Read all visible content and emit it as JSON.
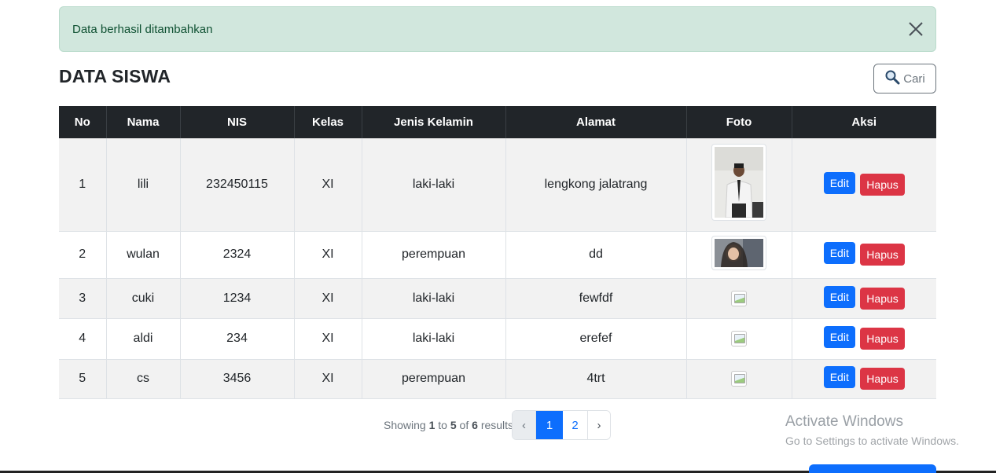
{
  "alert": {
    "message": "Data berhasil ditambahkan"
  },
  "page": {
    "title": "DATA SISWA"
  },
  "search": {
    "label": "Cari"
  },
  "table": {
    "columns": [
      "No",
      "Nama",
      "NIS",
      "Kelas",
      "Jenis Kelamin",
      "Alamat",
      "Foto",
      "Aksi"
    ],
    "rows": [
      {
        "no": "1",
        "nama": "lili",
        "nis": "232450115",
        "kelas": "XI",
        "jenis_kelamin": "laki-laki",
        "alamat": "lengkong jalatrang",
        "foto": "portrait-photo"
      },
      {
        "no": "2",
        "nama": "wulan",
        "nis": "2324",
        "kelas": "XI",
        "jenis_kelamin": "perempuan",
        "alamat": "dd",
        "foto": "landscape-photo"
      },
      {
        "no": "3",
        "nama": "cuki",
        "nis": "1234",
        "kelas": "XI",
        "jenis_kelamin": "laki-laki",
        "alamat": "fewfdf",
        "foto": "broken-image"
      },
      {
        "no": "4",
        "nama": "aldi",
        "nis": "234",
        "kelas": "XI",
        "jenis_kelamin": "laki-laki",
        "alamat": "erefef",
        "foto": "broken-image"
      },
      {
        "no": "5",
        "nama": "cs",
        "nis": "3456",
        "kelas": "XI",
        "jenis_kelamin": "perempuan",
        "alamat": "4trt",
        "foto": "broken-image"
      }
    ],
    "edit_label": "Edit",
    "delete_label": "Hapus"
  },
  "pagination": {
    "showing_prefix": "Showing",
    "from": "1",
    "to_word": "to",
    "to": "5",
    "of_word": "of",
    "total": "6",
    "results_word": "results",
    "prev": "‹",
    "pages": [
      "1",
      "2"
    ],
    "active_page": "1",
    "next": "›"
  },
  "watermark": {
    "line1": "Activate Windows",
    "line2": "Go to Settings to activate Windows."
  },
  "colors": {
    "primary": "#0d6efd",
    "danger": "#dc3545",
    "success_bg": "#d1e7dd",
    "header_dark": "#212529"
  }
}
